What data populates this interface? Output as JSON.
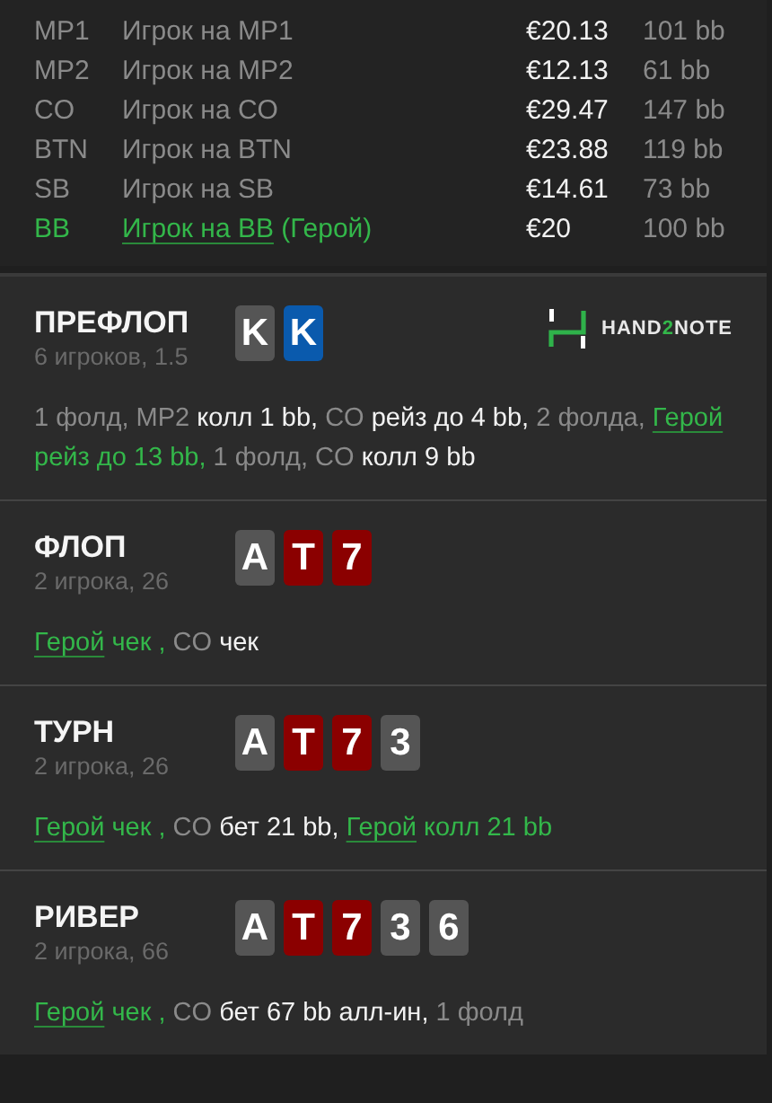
{
  "players": [
    {
      "position": "MP1",
      "name": "Игрок на MP1",
      "stack": "€20.13",
      "bb": "101 bb",
      "hero": false
    },
    {
      "position": "MP2",
      "name": "Игрок на MP2",
      "stack": "€12.13",
      "bb": "61 bb",
      "hero": false
    },
    {
      "position": "CO",
      "name": "Игрок на CO",
      "stack": "€29.47",
      "bb": "147 bb",
      "hero": false
    },
    {
      "position": "BTN",
      "name": "Игрок на BTN",
      "stack": "€23.88",
      "bb": "119 bb",
      "hero": false
    },
    {
      "position": "SB",
      "name": "Игрок на SB",
      "stack": "€14.61",
      "bb": "73 bb",
      "hero": false
    },
    {
      "position": "BB",
      "name": "Игрок на BB",
      "hero_tag": "(Герой)",
      "stack": "€20",
      "bb": "100 bb",
      "hero": true
    }
  ],
  "logo": [
    "HAND",
    "2",
    "NOTE"
  ],
  "streets": [
    {
      "title": "ПРЕФЛОП",
      "subtitle": "6 игроков, 1.5",
      "cards": [
        {
          "rank": "K",
          "color": "#555555"
        },
        {
          "rank": "K",
          "color": "#0a5aad"
        }
      ],
      "actions": [
        {
          "text": "1 фолд, MP2 ",
          "kind": "muted"
        },
        {
          "text": "колл 1 bb,",
          "kind": "strong"
        },
        {
          "text": " CO ",
          "kind": "muted"
        },
        {
          "text": "рейз до 4 bb,",
          "kind": "strong"
        },
        {
          "text": " 2 фолда, ",
          "kind": "muted"
        },
        {
          "text": "Герой",
          "kind": "hero"
        },
        {
          "text": " рейз до 13 bb,",
          "kind": "hero_action"
        },
        {
          "text": " 1 фолд, CO ",
          "kind": "muted"
        },
        {
          "text": "колл 9 bb",
          "kind": "strong"
        }
      ]
    },
    {
      "title": "ФЛОП",
      "subtitle": "2 игрока, 26",
      "cards": [
        {
          "rank": "A",
          "color": "#555555"
        },
        {
          "rank": "T",
          "color": "#8b0000"
        },
        {
          "rank": "7",
          "color": "#8b0000"
        }
      ],
      "actions": [
        {
          "text": "Герой",
          "kind": "hero"
        },
        {
          "text": " чек ,",
          "kind": "hero_action"
        },
        {
          "text": " CO ",
          "kind": "muted"
        },
        {
          "text": "чек",
          "kind": "strong"
        }
      ]
    },
    {
      "title": "ТУРН",
      "subtitle": "2 игрока, 26",
      "cards": [
        {
          "rank": "A",
          "color": "#555555"
        },
        {
          "rank": "T",
          "color": "#8b0000"
        },
        {
          "rank": "7",
          "color": "#8b0000"
        },
        {
          "rank": "3",
          "color": "#555555"
        }
      ],
      "actions": [
        {
          "text": "Герой",
          "kind": "hero"
        },
        {
          "text": " чек ,",
          "kind": "hero_action"
        },
        {
          "text": " CO ",
          "kind": "muted"
        },
        {
          "text": "бет 21 bb, ",
          "kind": "strong"
        },
        {
          "text": "Герой",
          "kind": "hero"
        },
        {
          "text": " колл 21 bb",
          "kind": "hero_action"
        }
      ]
    },
    {
      "title": "РИВЕР",
      "subtitle": "2 игрока, 66",
      "cards": [
        {
          "rank": "A",
          "color": "#555555"
        },
        {
          "rank": "T",
          "color": "#8b0000"
        },
        {
          "rank": "7",
          "color": "#8b0000"
        },
        {
          "rank": "3",
          "color": "#555555"
        },
        {
          "rank": "6",
          "color": "#555555"
        }
      ],
      "actions": [
        {
          "text": "Герой",
          "kind": "hero"
        },
        {
          "text": " чек ,",
          "kind": "hero_action"
        },
        {
          "text": " CO ",
          "kind": "muted"
        },
        {
          "text": "бет 67 bb алл-ин,",
          "kind": "strong"
        },
        {
          "text": " 1 фолд",
          "kind": "muted"
        }
      ]
    }
  ]
}
